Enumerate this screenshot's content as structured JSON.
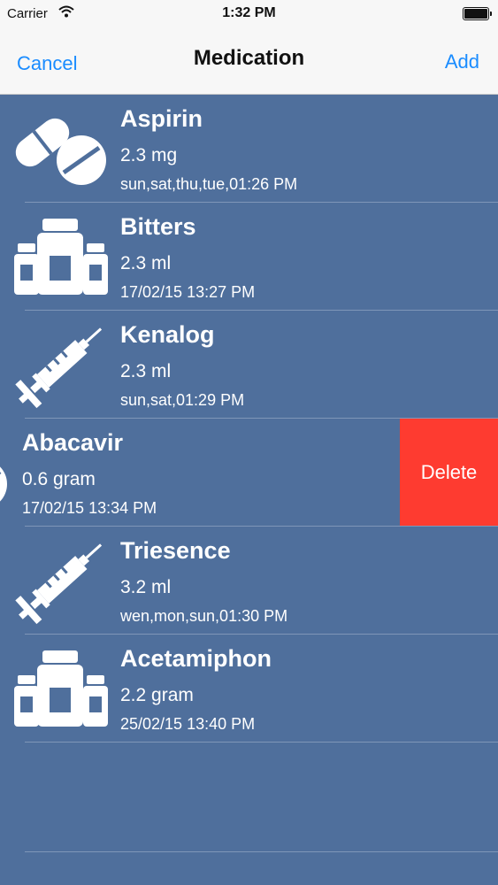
{
  "status_bar": {
    "carrier": "Carrier",
    "time": "1:32 PM"
  },
  "nav": {
    "cancel_label": "Cancel",
    "title": "Medication",
    "add_label": "Add"
  },
  "medications": [
    {
      "name": "Aspirin",
      "dose": "2.3 mg",
      "schedule": "sun,sat,thu,tue,01:26 PM",
      "icon": "pills-icon"
    },
    {
      "name": "Bitters",
      "dose": "2.3 ml",
      "schedule": "17/02/15 13:27 PM",
      "icon": "bottles-icon"
    },
    {
      "name": "Kenalog",
      "dose": "2.3 ml",
      "schedule": "sun,sat,01:29 PM",
      "icon": "syringe-icon"
    },
    {
      "name": "Abacavir",
      "dose": "0.6 gram",
      "schedule": "17/02/15 13:34 PM",
      "icon": "pills-icon",
      "swiped": true
    },
    {
      "name": "Triesence",
      "dose": "3.2 ml",
      "schedule": "wen,mon,sun,01:30 PM",
      "icon": "syringe-icon"
    },
    {
      "name": "Acetamiphon",
      "dose": "2.2 gram",
      "schedule": "25/02/15 13:40 PM",
      "icon": "bottles-icon"
    }
  ],
  "delete_label": "Delete",
  "colors": {
    "background": "#4f6f9c",
    "accent": "#1a8cff",
    "delete": "#fe3b30"
  }
}
